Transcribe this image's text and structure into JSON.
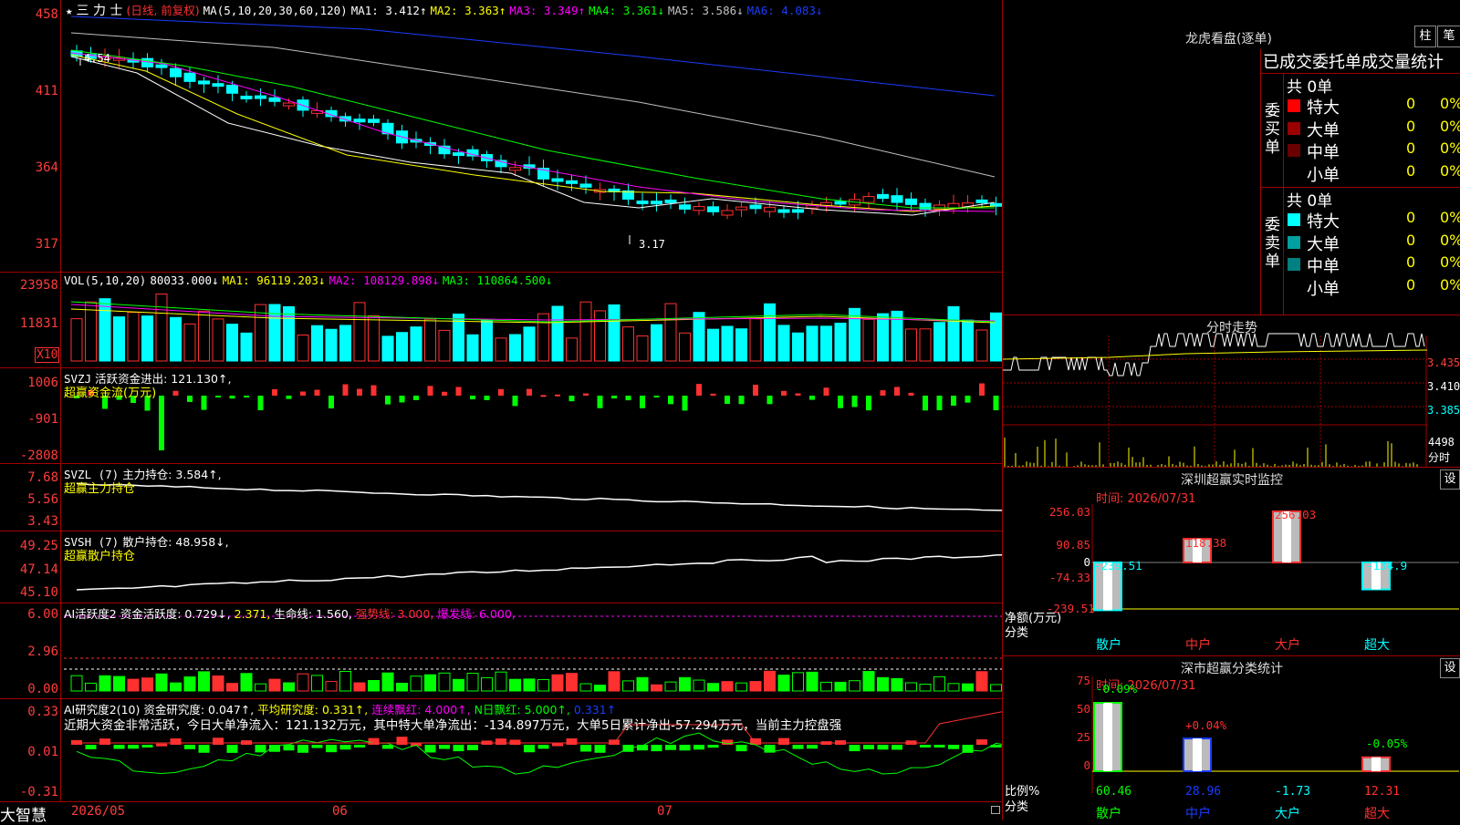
{
  "colors": {
    "up": "#ff3030",
    "down": "#00ffff",
    "ma1": "#ffffff",
    "ma2": "#ffff00",
    "ma3": "#ff00ff",
    "ma4": "#00ff00",
    "ma5": "#c0c0c0",
    "ma6": "#1a3cff",
    "grid": "#a00000",
    "axis": "#ff3c3c"
  },
  "price_panel": {
    "header": {
      "star": "★",
      "name": "三 力 士",
      "period": "(日线, 前复权)",
      "ma_params": "MA(5,10,20,30,60,120)",
      "ma1": "MA1: 3.412↑",
      "ma2": "MA2: 3.363↑",
      "ma3": "MA3: 3.349↑",
      "ma4": "MA4: 3.361↓",
      "ma5": "MA5: 3.586↓",
      "ma6": "MA6: 4.083↓"
    },
    "y_labels": [
      "458",
      "411",
      "364",
      "317"
    ],
    "high_label": "4.54",
    "low_label": "3.17"
  },
  "vol_panel": {
    "header": {
      "name": "VOL(5,10,20)",
      "vol": "80033.000↓",
      "ma1": "MA1: 96119.203↓",
      "ma2": "MA2: 108129.898↓",
      "ma3": "MA3: 110864.500↓"
    },
    "y_labels": [
      "23958",
      "11831"
    ],
    "unit": "X10"
  },
  "svzj_panel": {
    "header": {
      "name": "SVZJ",
      "value": "活跃资金进出: 121.130↑,",
      "sub": "超赢资金流(万元)"
    },
    "y_labels": [
      "1006",
      "-901",
      "-2808"
    ]
  },
  "svzl_panel": {
    "header": {
      "name": "SVZL (7)",
      "value": "主力持仓: 3.584↑,",
      "sub": "超赢主力持仓"
    },
    "y_labels": [
      "7.68",
      "5.56",
      "3.43"
    ]
  },
  "svsh_panel": {
    "header": {
      "name": "SVSH (7)",
      "value": "散户持仓: 48.958↓,",
      "sub": "超赢散户持仓"
    },
    "y_labels": [
      "49.25",
      "47.14",
      "45.10"
    ]
  },
  "ai_active_panel": {
    "header": {
      "name": "AI活跃度2",
      "v1": "资金活跃度: 0.729↓,",
      "v2": "2.371,",
      "v3": "生命线: 1.560,",
      "v4": "强势线: 3.000,",
      "v5": "爆发线: 6.000,"
    },
    "y_labels": [
      "6.00",
      "2.96",
      "0.00"
    ]
  },
  "ai_research_panel": {
    "header": {
      "name": "AI研究度2(10)",
      "v1": "资金研究度: 0.047↑,",
      "v2": "平均研究度: 0.331↑,",
      "v3": "连续飘红: 4.000↑,",
      "v4": "N日飘红: 5.000↑,",
      "v5": "0.331↑"
    },
    "commentary": "近期大资金非常活跃，今日大单净流入：121.132万元，其中特大单净流出：-134.897万元，大单5日累计净出-57.294万元，当前主力控盘强",
    "y_labels": [
      "0.33",
      "0.01",
      "-0.31"
    ]
  },
  "bottom_bar": {
    "logo": "大智慧",
    "date_labels": [
      "2026/05",
      "06",
      "07"
    ]
  },
  "lhb": {
    "title": "龙虎看盘(逐单)",
    "btn_zhu": "柱",
    "btn_bi": "笔",
    "heading": "已成交委托单成交量统计",
    "buy_label": "委买单",
    "sell_label": "委卖单",
    "buy_total": "共 0单",
    "sell_total": "共 0单",
    "buy_rows": [
      {
        "name": "特大",
        "count": "0",
        "pct": "0%",
        "color": "#ff0000"
      },
      {
        "name": "大单",
        "count": "0",
        "pct": "0%",
        "color": "#9b0000"
      },
      {
        "name": "中单",
        "count": "0",
        "pct": "0%",
        "color": "#6a0000"
      },
      {
        "name": "小单",
        "count": "0",
        "pct": "0%",
        "color": "#000000"
      }
    ],
    "sell_rows": [
      {
        "name": "特大",
        "count": "0",
        "pct": "0%",
        "color": "#00ffff"
      },
      {
        "name": "大单",
        "count": "0",
        "pct": "0%",
        "color": "#00a0a0"
      },
      {
        "name": "中单",
        "count": "0",
        "pct": "0%",
        "color": "#008080"
      },
      {
        "name": "小单",
        "count": "0",
        "pct": "0%",
        "color": "#000000"
      }
    ]
  },
  "intraday": {
    "title": "分时走势",
    "price_labels": [
      "3.435",
      "3.410",
      "3.385"
    ],
    "vol_label": "4498",
    "vol_unit": "分时"
  },
  "sz_monitor": {
    "title": "深圳超赢实时监控",
    "btn": "设",
    "time": "时间: 2026/07/31",
    "y_labels": [
      "256.03",
      "90.85",
      "0",
      "-74.33",
      "-239.51"
    ],
    "axis_title": "净额(万元)",
    "cat_title": "分类",
    "categories": [
      "散户",
      "中户",
      "大户",
      "超大"
    ],
    "values": [
      -239.51,
      118.38,
      256.03,
      -134.9
    ],
    "value_labels": [
      "-239.51",
      "118.38",
      "256.03",
      "-134.9"
    ]
  },
  "sz_stats": {
    "title": "深市超赢分类统计",
    "btn": "设",
    "time": "时间: 2026/07/31",
    "y_labels": [
      "75",
      "50",
      "25",
      "0"
    ],
    "axis_title": "比例%",
    "cat_title": "分类",
    "categories": [
      "散户",
      "中户",
      "大户",
      "超大"
    ],
    "values": [
      60.46,
      28.96,
      -1.73,
      12.31
    ],
    "value_labels": [
      "60.46",
      "28.96",
      "-1.73",
      "12.31"
    ],
    "change_labels": [
      "-0.09%",
      "+0.04%",
      "",
      "-0.05%"
    ]
  }
}
